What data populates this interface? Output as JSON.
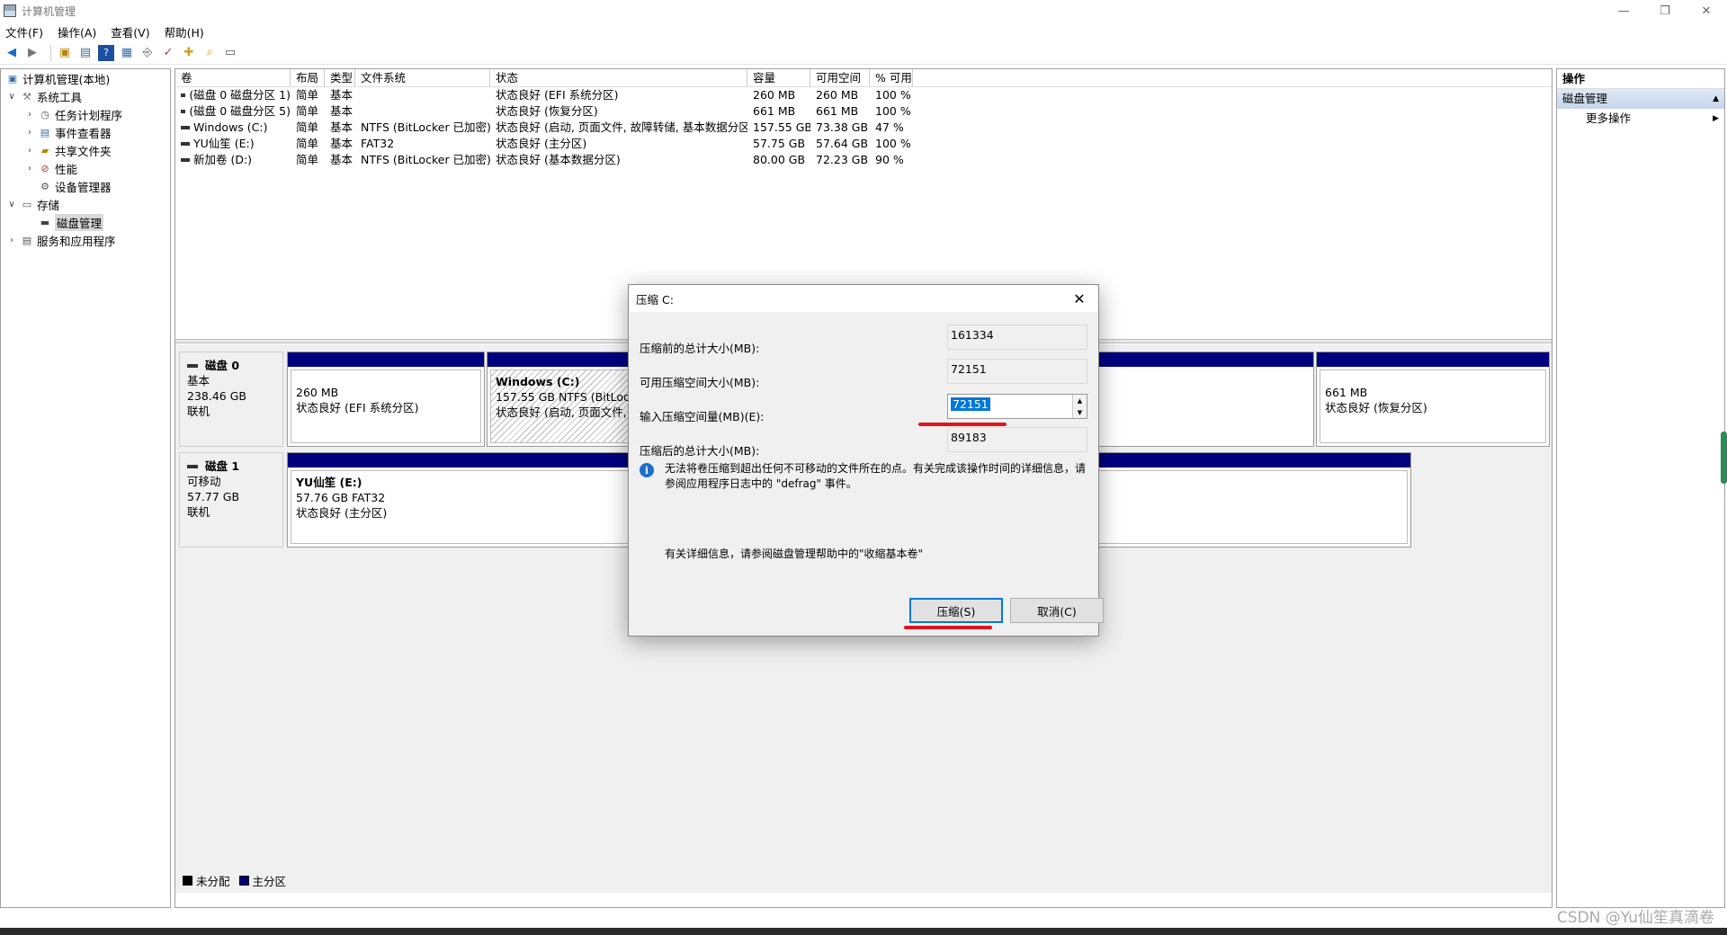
{
  "window": {
    "title": "计算机管理",
    "controls": [
      "—",
      "❐",
      "✕"
    ]
  },
  "menu": [
    "文件(F)",
    "操作(A)",
    "查看(V)",
    "帮助(H)"
  ],
  "tree": [
    {
      "label": "计算机管理(本地)",
      "level": 0,
      "expander": ""
    },
    {
      "label": "系统工具",
      "level": 1,
      "expander": "∨"
    },
    {
      "label": "任务计划程序",
      "level": 2,
      "expander": "›"
    },
    {
      "label": "事件查看器",
      "level": 2,
      "expander": "›"
    },
    {
      "label": "共享文件夹",
      "level": 2,
      "expander": "›"
    },
    {
      "label": "性能",
      "level": 2,
      "expander": "›"
    },
    {
      "label": "设备管理器",
      "level": 2,
      "expander": ""
    },
    {
      "label": "存储",
      "level": 1,
      "expander": "∨"
    },
    {
      "label": "磁盘管理",
      "level": 2,
      "expander": ""
    },
    {
      "label": "服务和应用程序",
      "level": 1,
      "expander": "›"
    }
  ],
  "volume_table": {
    "headers": [
      "卷",
      "布局",
      "类型",
      "文件系统",
      "状态",
      "容量",
      "可用空间",
      "% 可用"
    ],
    "rows": [
      [
        "(磁盘 0 磁盘分区 1)",
        "简单",
        "基本",
        "",
        "状态良好 (EFI 系统分区)",
        "260 MB",
        "260 MB",
        "100 %"
      ],
      [
        "(磁盘 0 磁盘分区 5)",
        "简单",
        "基本",
        "",
        "状态良好 (恢复分区)",
        "661 MB",
        "661 MB",
        "100 %"
      ],
      [
        "Windows (C:)",
        "简单",
        "基本",
        "NTFS (BitLocker 已加密)",
        "状态良好 (启动, 页面文件, 故障转储, 基本数据分区)",
        "157.55 GB",
        "73.38 GB",
        "47 %"
      ],
      [
        "YU仙笙 (E:)",
        "简单",
        "基本",
        "FAT32",
        "状态良好 (主分区)",
        "57.75 GB",
        "57.64 GB",
        "100 %"
      ],
      [
        "新加卷 (D:)",
        "简单",
        "基本",
        "NTFS (BitLocker 已加密)",
        "状态良好 (基本数据分区)",
        "80.00 GB",
        "72.23 GB",
        "90 %"
      ]
    ]
  },
  "disks": {
    "disk0": {
      "name": "磁盘 0",
      "type": "基本",
      "size": "238.46 GB",
      "status": "联机",
      "p1": {
        "size": "260 MB",
        "status": "状态良好 (EFI 系统分区)"
      },
      "p2": {
        "name": "Windows  (C:)",
        "size": "157.55 GB NTFS (BitLocker",
        "status": "状态良好 (启动, 页面文件, 故"
      },
      "p3": {
        "size": "661 MB",
        "status": "状态良好 (恢复分区)"
      }
    },
    "disk1": {
      "name": "磁盘 1",
      "type": "可移动",
      "size": "57.77 GB",
      "status": "联机",
      "p1": {
        "name": "YU仙笙  (E:)",
        "size": "57.76 GB FAT32",
        "status": "状态良好 (主分区)"
      }
    }
  },
  "legend": {
    "unallocated": "未分配",
    "primary": "主分区",
    "unallocated_color": "#000000",
    "primary_color": "#00007f"
  },
  "actions": {
    "header": "操作",
    "section": "磁盘管理",
    "more": "更多操作"
  },
  "dialog": {
    "title": "压缩 C:",
    "total_before_label": "压缩前的总计大小(MB):",
    "total_before": "161334",
    "available_label": "可用压缩空间大小(MB):",
    "available": "72151",
    "input_label": "输入压缩空间量(MB)(E):",
    "input_value": "72151",
    "total_after_label": "压缩后的总计大小(MB):",
    "total_after": "89183",
    "info": "无法将卷压缩到超出任何不可移动的文件所在的点。有关完成该操作时间的详细信息，请参阅应用程序日志中的 \"defrag\" 事件。",
    "more_info": "有关详细信息，请参阅磁盘管理帮助中的\"收缩基本卷\"",
    "ok": "压缩(S)",
    "cancel": "取消(C)"
  },
  "watermark": "CSDN @Yu仙笙真滴卷",
  "colors": {
    "accent": "#0078d7",
    "highlight_red": "#e0151f",
    "partition_bar": "#00007f"
  }
}
